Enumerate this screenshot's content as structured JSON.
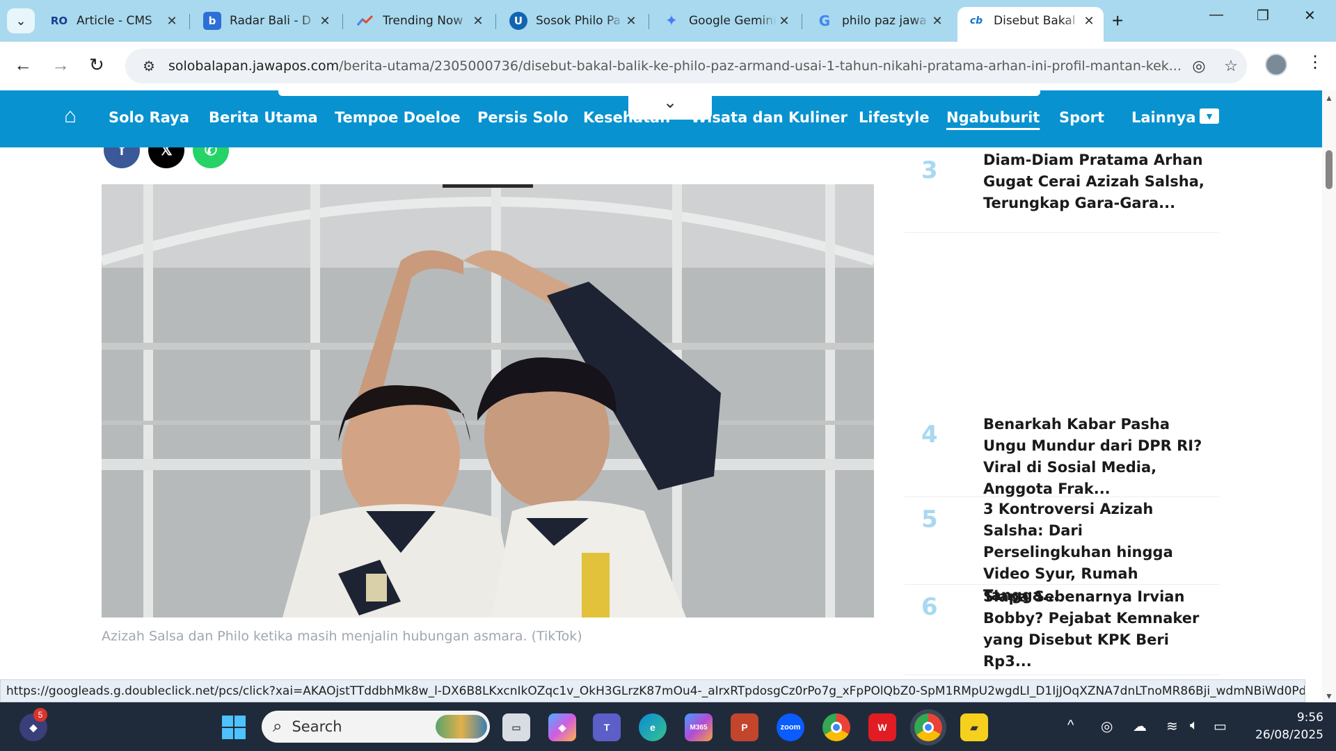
{
  "browser": {
    "tabs": [
      {
        "title": "Article - CMS",
        "favicon": "RO",
        "color": "#1a3c8f"
      },
      {
        "title": "Radar Bali - D",
        "favicon": "b",
        "color": "#2d6fd6"
      },
      {
        "title": "Trending Now",
        "favicon": "trend-icon",
        "color": "#e24a2e"
      },
      {
        "title": "Sosok Philo Pa",
        "favicon": "U",
        "color": "#1264b1"
      },
      {
        "title": "Google Gemini",
        "favicon": "gemini-icon",
        "color": "#4a7bf7"
      },
      {
        "title": "philo paz jawa",
        "favicon": "G",
        "color": "#4285f4"
      },
      {
        "title": "Disebut Bakal",
        "favicon": "solo-icon",
        "color": "#1676c9",
        "active": true
      }
    ],
    "url_domain": "solobalapan.jawapos.com",
    "url_path": "/berita-utama/2305000736/disebut-bakal-balik-ke-philo-paz-armand-usai-1-tahun-nikahi-pratama-arhan-ini-profil-mantan-kek..."
  },
  "site_nav": {
    "items": [
      "Solo Raya",
      "Berita Utama",
      "Tempoe Doeloe",
      "Persis Solo",
      "Kesehatan",
      "Wisata dan Kuliner",
      "Lifestyle",
      "Ngabuburit",
      "Sport",
      "Lainnya"
    ],
    "current": "Ngabuburit",
    "accent": "#0892d0"
  },
  "article": {
    "caption": "Azizah Salsa dan Philo ketika masih menjalin hubungan asmara. (TikTok)",
    "share": [
      "facebook-icon",
      "x-icon",
      "whatsapp-icon"
    ]
  },
  "trending": [
    {
      "rank": "3",
      "title": "Diam-Diam Pratama Arhan Gugat Cerai Azizah Salsha, Terungkap Gara-Gara..."
    },
    {
      "rank": "4",
      "title": "Benarkah Kabar Pasha Ungu Mundur dari DPR RI? Viral di Sosial Media, Anggota Frak..."
    },
    {
      "rank": "5",
      "title": "3 Kontroversi Azizah Salsha: Dari Perselingkuhan hingga Video Syur, Rumah Tangga..."
    },
    {
      "rank": "6",
      "title": "Siapa Sebenarnya Irvian Bobby? Pejabat Kemnaker yang Disebut KPK Beri Rp3..."
    }
  ],
  "status_url": "https://googleads.g.doubleclick.net/pcs/click?xai=AKAOjstTTddbhMk8w_l-DX6B8LKxcnIkOZqc1v_OkH3GLrzK87mOu4-_aIrxRTpdosgCz0rPo7g_xFpPOlQbZ0-SpM1RMpU2wgdLI_D1IjJOqXZNA7dnLTnoMR86Bji_wdmNBiWd0Pdf8GVlRtcii...",
  "taskbar": {
    "search_label": "Search",
    "notification_count": "5",
    "time": "9:56",
    "date": "26/08/2025"
  }
}
